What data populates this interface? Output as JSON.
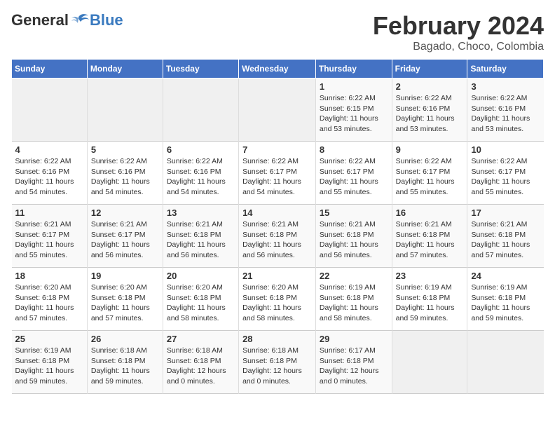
{
  "header": {
    "logo_general": "General",
    "logo_blue": "Blue",
    "month_title": "February 2024",
    "location": "Bagado, Choco, Colombia"
  },
  "days_of_week": [
    "Sunday",
    "Monday",
    "Tuesday",
    "Wednesday",
    "Thursday",
    "Friday",
    "Saturday"
  ],
  "weeks": [
    [
      {
        "day": "",
        "info": ""
      },
      {
        "day": "",
        "info": ""
      },
      {
        "day": "",
        "info": ""
      },
      {
        "day": "",
        "info": ""
      },
      {
        "day": "1",
        "info": "Sunrise: 6:22 AM\nSunset: 6:15 PM\nDaylight: 11 hours\nand 53 minutes."
      },
      {
        "day": "2",
        "info": "Sunrise: 6:22 AM\nSunset: 6:16 PM\nDaylight: 11 hours\nand 53 minutes."
      },
      {
        "day": "3",
        "info": "Sunrise: 6:22 AM\nSunset: 6:16 PM\nDaylight: 11 hours\nand 53 minutes."
      }
    ],
    [
      {
        "day": "4",
        "info": "Sunrise: 6:22 AM\nSunset: 6:16 PM\nDaylight: 11 hours\nand 54 minutes."
      },
      {
        "day": "5",
        "info": "Sunrise: 6:22 AM\nSunset: 6:16 PM\nDaylight: 11 hours\nand 54 minutes."
      },
      {
        "day": "6",
        "info": "Sunrise: 6:22 AM\nSunset: 6:16 PM\nDaylight: 11 hours\nand 54 minutes."
      },
      {
        "day": "7",
        "info": "Sunrise: 6:22 AM\nSunset: 6:17 PM\nDaylight: 11 hours\nand 54 minutes."
      },
      {
        "day": "8",
        "info": "Sunrise: 6:22 AM\nSunset: 6:17 PM\nDaylight: 11 hours\nand 55 minutes."
      },
      {
        "day": "9",
        "info": "Sunrise: 6:22 AM\nSunset: 6:17 PM\nDaylight: 11 hours\nand 55 minutes."
      },
      {
        "day": "10",
        "info": "Sunrise: 6:22 AM\nSunset: 6:17 PM\nDaylight: 11 hours\nand 55 minutes."
      }
    ],
    [
      {
        "day": "11",
        "info": "Sunrise: 6:21 AM\nSunset: 6:17 PM\nDaylight: 11 hours\nand 55 minutes."
      },
      {
        "day": "12",
        "info": "Sunrise: 6:21 AM\nSunset: 6:17 PM\nDaylight: 11 hours\nand 56 minutes."
      },
      {
        "day": "13",
        "info": "Sunrise: 6:21 AM\nSunset: 6:18 PM\nDaylight: 11 hours\nand 56 minutes."
      },
      {
        "day": "14",
        "info": "Sunrise: 6:21 AM\nSunset: 6:18 PM\nDaylight: 11 hours\nand 56 minutes."
      },
      {
        "day": "15",
        "info": "Sunrise: 6:21 AM\nSunset: 6:18 PM\nDaylight: 11 hours\nand 56 minutes."
      },
      {
        "day": "16",
        "info": "Sunrise: 6:21 AM\nSunset: 6:18 PM\nDaylight: 11 hours\nand 57 minutes."
      },
      {
        "day": "17",
        "info": "Sunrise: 6:21 AM\nSunset: 6:18 PM\nDaylight: 11 hours\nand 57 minutes."
      }
    ],
    [
      {
        "day": "18",
        "info": "Sunrise: 6:20 AM\nSunset: 6:18 PM\nDaylight: 11 hours\nand 57 minutes."
      },
      {
        "day": "19",
        "info": "Sunrise: 6:20 AM\nSunset: 6:18 PM\nDaylight: 11 hours\nand 57 minutes."
      },
      {
        "day": "20",
        "info": "Sunrise: 6:20 AM\nSunset: 6:18 PM\nDaylight: 11 hours\nand 58 minutes."
      },
      {
        "day": "21",
        "info": "Sunrise: 6:20 AM\nSunset: 6:18 PM\nDaylight: 11 hours\nand 58 minutes."
      },
      {
        "day": "22",
        "info": "Sunrise: 6:19 AM\nSunset: 6:18 PM\nDaylight: 11 hours\nand 58 minutes."
      },
      {
        "day": "23",
        "info": "Sunrise: 6:19 AM\nSunset: 6:18 PM\nDaylight: 11 hours\nand 59 minutes."
      },
      {
        "day": "24",
        "info": "Sunrise: 6:19 AM\nSunset: 6:18 PM\nDaylight: 11 hours\nand 59 minutes."
      }
    ],
    [
      {
        "day": "25",
        "info": "Sunrise: 6:19 AM\nSunset: 6:18 PM\nDaylight: 11 hours\nand 59 minutes."
      },
      {
        "day": "26",
        "info": "Sunrise: 6:18 AM\nSunset: 6:18 PM\nDaylight: 11 hours\nand 59 minutes."
      },
      {
        "day": "27",
        "info": "Sunrise: 6:18 AM\nSunset: 6:18 PM\nDaylight: 12 hours\nand 0 minutes."
      },
      {
        "day": "28",
        "info": "Sunrise: 6:18 AM\nSunset: 6:18 PM\nDaylight: 12 hours\nand 0 minutes."
      },
      {
        "day": "29",
        "info": "Sunrise: 6:17 AM\nSunset: 6:18 PM\nDaylight: 12 hours\nand 0 minutes."
      },
      {
        "day": "",
        "info": ""
      },
      {
        "day": "",
        "info": ""
      }
    ]
  ]
}
